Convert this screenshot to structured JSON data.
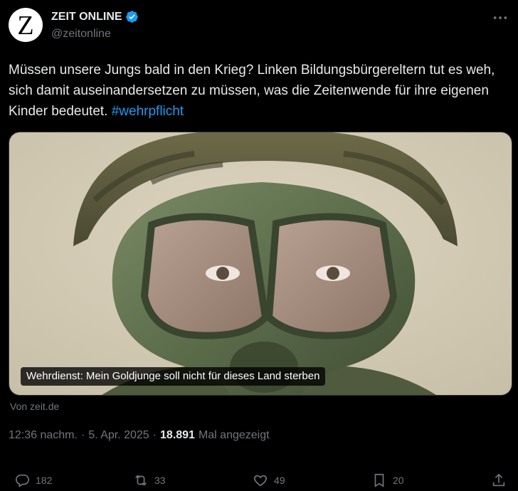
{
  "account": {
    "avatar_letter": "Z",
    "display_name": "ZEIT ONLINE",
    "handle": "@zeitonline",
    "verified_icon": "verified-badge-icon"
  },
  "tweet": {
    "text": "Müssen unsere Jungs bald in den Krieg? Linken Bildungsbürgereltern tut es weh, sich damit auseinandersetzen zu müssen, was die Zeitenwende für ihre eigenen Kinder bedeutet.",
    "hashtag": "#wehrpflicht"
  },
  "card": {
    "caption": "Wehrdienst: Mein Goldjunge soll nicht für dieses Land sterben",
    "source": "Von zeit.de"
  },
  "meta": {
    "time": "12:36 nachm.",
    "separator": "·",
    "date": "5. Apr. 2025",
    "views_count": "18.891",
    "views_label": "Mal angezeigt"
  },
  "actions": {
    "replies": "182",
    "reposts": "33",
    "likes": "49",
    "bookmarks": "20"
  },
  "colors": {
    "background": "#000000",
    "text": "#e7e9ea",
    "secondary": "#71767b",
    "accent": "#1d9bf0"
  }
}
